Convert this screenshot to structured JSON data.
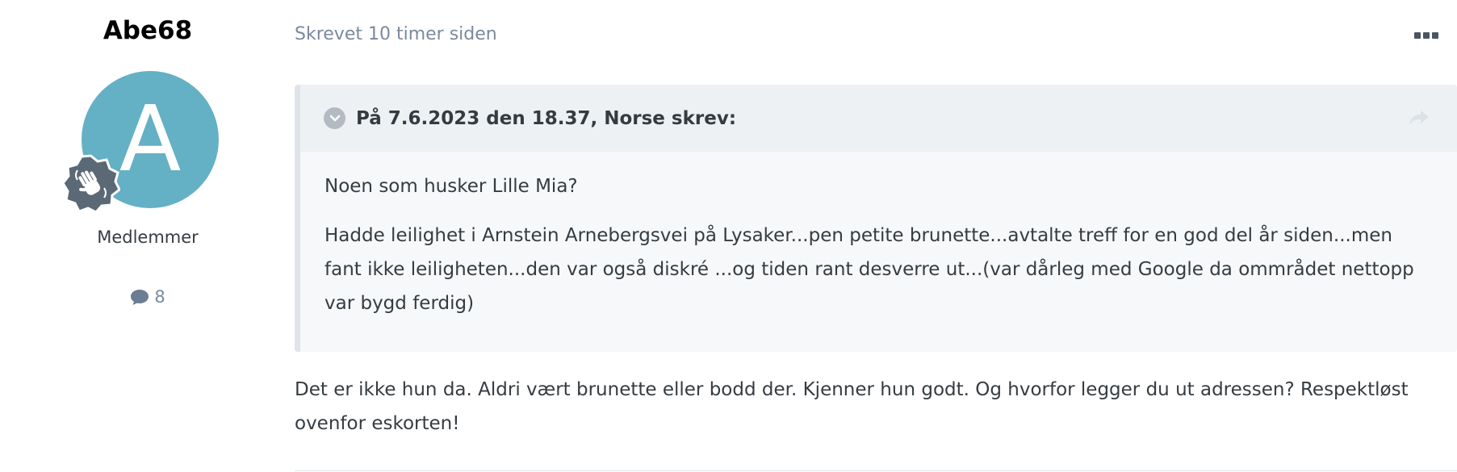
{
  "author": {
    "name": "Abe68",
    "avatar_letter": "A",
    "avatar_color": "#64b0c5",
    "rank_icon": "wave-hand-badge-icon",
    "group": "Medlemmer",
    "post_count": "8",
    "post_count_icon": "comment-icon"
  },
  "post": {
    "timestamp": "Skrevet 10 timer siden",
    "menu_icon": "ellipsis-icon",
    "quote": {
      "citation": "På 7.6.2023 den 18.37, Norse skrev:",
      "toggle_icon": "chevron-down-icon",
      "share_icon": "share-icon",
      "paragraph_1": "Noen som husker Lille Mia?",
      "paragraph_2": "Hadde leilighet i Arnstein Arnebergsvei på Lysaker...pen petite brunette...avtalte treff for en god del år siden...men fant ikke leiligheten...den var også diskré ...og tiden rant desverre ut...(var dårleg med Google da ommrådet nettopp var bygd ferdig)"
    },
    "reply": "Det er ikke hun da. Aldri vært brunette eller bodd der. Kjenner hun godt. Og hvorfor legger du ut adressen? Respektløst ovenfor eskorten!"
  },
  "colors": {
    "accent_avatar": "#64b0c5",
    "muted_text": "#7a8a9e",
    "quote_bg": "#f6f8fa",
    "quote_header_bg": "#edf1f4"
  }
}
